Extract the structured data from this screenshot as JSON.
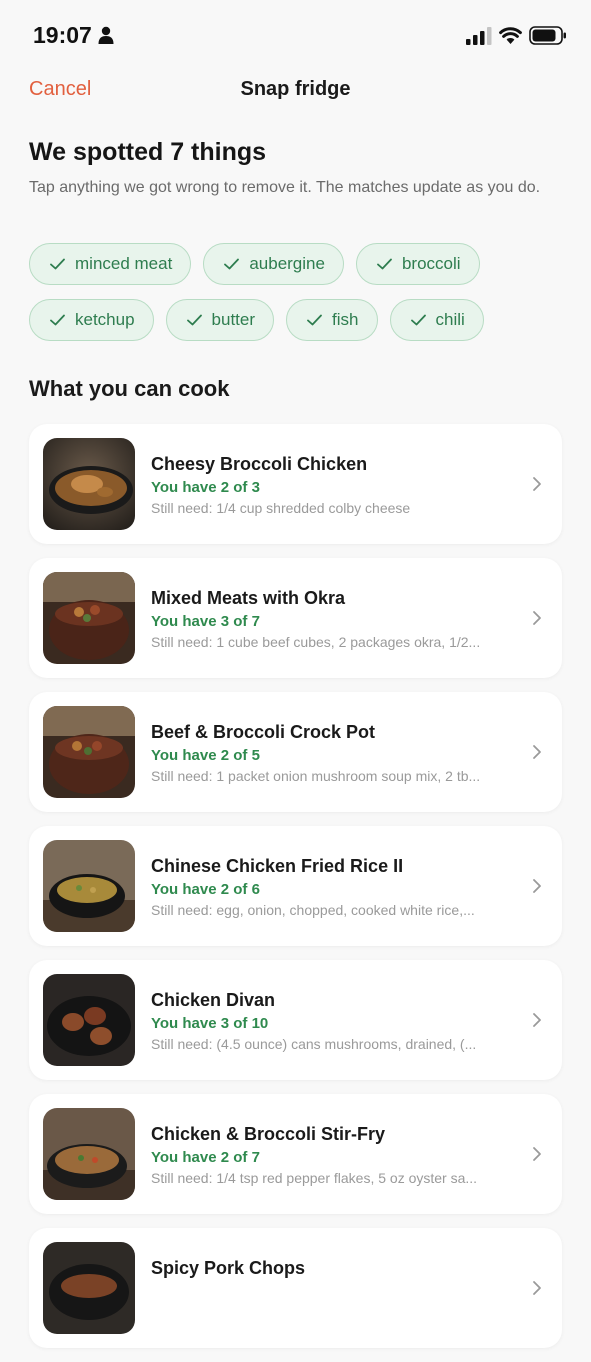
{
  "status_bar": {
    "time": "19:07"
  },
  "nav": {
    "cancel_label": "Cancel",
    "title": "Snap fridge"
  },
  "summary": {
    "heading": "We spotted 7 things",
    "subtext": "Tap anything we got wrong to remove it. The matches update as you do."
  },
  "ingredients": [
    {
      "label": "minced meat"
    },
    {
      "label": "aubergine"
    },
    {
      "label": "broccoli"
    },
    {
      "label": "ketchup"
    },
    {
      "label": "butter"
    },
    {
      "label": "fish"
    },
    {
      "label": "chili"
    }
  ],
  "section_title": "What you can cook",
  "recipes": [
    {
      "title": "Cheesy Broccoli Chicken",
      "have": "You have 2 of 3",
      "need": "Still need: 1/4 cup shredded colby cheese"
    },
    {
      "title": "Mixed Meats with Okra",
      "have": "You have 3 of 7",
      "need": "Still need: 1 cube beef cubes, 2 packages okra, 1/2..."
    },
    {
      "title": "Beef & Broccoli Crock Pot",
      "have": "You have 2 of 5",
      "need": "Still need: 1 packet onion mushroom soup mix, 2 tb..."
    },
    {
      "title": "Chinese Chicken Fried Rice II",
      "have": "You have 2 of 6",
      "need": "Still need: egg, onion, chopped, cooked white rice,..."
    },
    {
      "title": "Chicken Divan",
      "have": "You have 3 of 10",
      "need": "Still need: (4.5 ounce) cans mushrooms, drained, (..."
    },
    {
      "title": "Chicken & Broccoli Stir-Fry",
      "have": "You have 2 of 7",
      "need": "Still need: 1/4 tsp red pepper flakes, 5 oz oyster sa..."
    },
    {
      "title": "Spicy Pork Chops",
      "have": "",
      "need": ""
    }
  ],
  "colors": {
    "accent": "#e2603f",
    "chip_bg": "#e8f4ec",
    "chip_border": "#b8dcc4",
    "chip_text": "#2e7d4f",
    "have_text": "#2f8a4e"
  }
}
